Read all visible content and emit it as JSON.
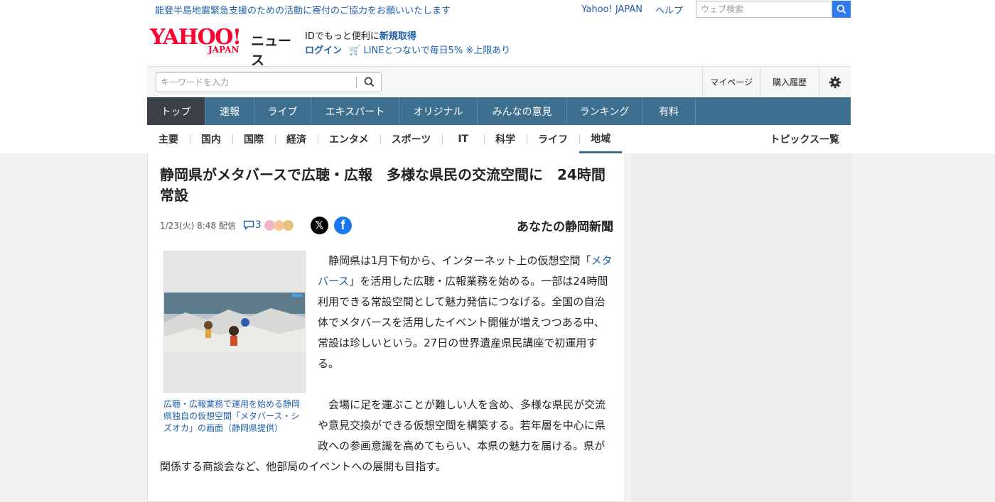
{
  "notice": {
    "text": "能登半島地震緊急支援のための活動に寄付のご協力をお願いいたします"
  },
  "top_links": {
    "yahoo_japan": "Yahoo! JAPAN",
    "help": "ヘルプ"
  },
  "web_search": {
    "placeholder": "ウェブ検索"
  },
  "logo": {
    "yahoo": "YAHOO!",
    "japan": "JAPAN",
    "news": "ニュース"
  },
  "promo": {
    "line1_prefix": "IDでもっと便利に",
    "line1_link": "新規取得",
    "login": "ログイン",
    "line2": "LINEとつないで毎日5% ※上限あり"
  },
  "keyword_search": {
    "placeholder": "キーワードを入力"
  },
  "header_right": {
    "mypage": "マイページ",
    "purchase_history": "購入履歴"
  },
  "main_nav": [
    {
      "label": "トップ",
      "active": true
    },
    {
      "label": "速報"
    },
    {
      "label": "ライブ"
    },
    {
      "label": "エキスパート"
    },
    {
      "label": "オリジナル"
    },
    {
      "label": "みんなの意見"
    },
    {
      "label": "ランキング"
    },
    {
      "label": "有料"
    }
  ],
  "sub_nav": [
    {
      "label": "主要"
    },
    {
      "label": "国内"
    },
    {
      "label": "国際"
    },
    {
      "label": "経済"
    },
    {
      "label": "エンタメ"
    },
    {
      "label": "スポーツ"
    },
    {
      "label": "IT"
    },
    {
      "label": "科学"
    },
    {
      "label": "ライフ"
    },
    {
      "label": "地域",
      "active": true
    }
  ],
  "topics_list": "トピックス一覧",
  "article": {
    "title": "静岡県がメタバースで広聴・広報　多様な県民の交流空間に　24時間常設",
    "date": "1/23(火) 8:48 配信",
    "comment_count": "3",
    "publisher": "あなたの静岡新聞",
    "image_caption": "広聴・広報業務で運用を始める静岡県独自の仮想空間「メタバース・シズオカ」の画面（静岡県提供）",
    "para1_pre": "　静岡県は1月下旬から、インターネット上の仮想空間「",
    "para1_link": "メタバース",
    "para1_post": "」を活用した広聴・広報業務を始める。一部は24時間利用できる常設空間として魅力発信につなげる。全国の自治体でメタバースを活用したイベント開催が増えつつある中、常設は珍しいという。27日の世界遺産県民講座で初運用する。",
    "para2": "　会場に足を運ぶことが難しい人を含め、多様な県民が交流や意見交換ができる仮想空間を構築する。若年層を中心に県政への参画意識を高めてもらい、本県の魅力を届ける。県が関係する商談会など、他部局のイベントへの展開も目指す。"
  },
  "colors": {
    "accent_blue": "#1f5fa8",
    "nav_bg": "#3f6f8f",
    "nav_active": "#3a3f48",
    "yahoo_red": "#ff0033",
    "search_btn": "#2f7af0"
  }
}
